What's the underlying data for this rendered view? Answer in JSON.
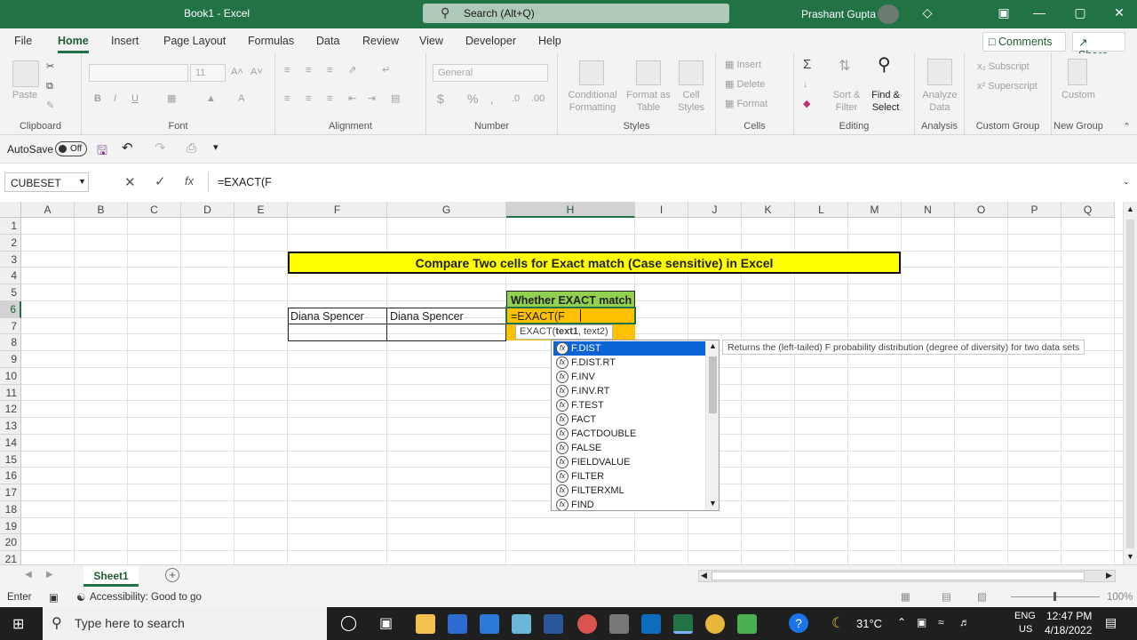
{
  "titlebar": {
    "title": "Book1  -  Excel",
    "search_placeholder": "Search (Alt+Q)",
    "user": "Prashant Gupta"
  },
  "menu": {
    "tabs": [
      "File",
      "Home",
      "Insert",
      "Page Layout",
      "Formulas",
      "Data",
      "Review",
      "View",
      "Developer",
      "Help"
    ],
    "active": "Home",
    "comments": "Comments",
    "share": "Share"
  },
  "ribbon": {
    "clipboard": {
      "label": "Clipboard",
      "paste": "Paste"
    },
    "font": {
      "label": "Font",
      "size": "11"
    },
    "alignment": {
      "label": "Alignment"
    },
    "number": {
      "label": "Number",
      "format": "General"
    },
    "styles": {
      "label": "Styles",
      "conditional": "Conditional\nFormatting",
      "format_table": "Format as\nTable",
      "cell_styles": "Cell\nStyles"
    },
    "cells": {
      "label": "Cells",
      "insert": "Insert",
      "delete": "Delete",
      "format": "Format"
    },
    "editing": {
      "label": "Editing",
      "sort": "Sort &\nFilter",
      "find": "Find &\nSelect"
    },
    "analysis": {
      "label": "Analysis",
      "analyze": "Analyze\nData"
    },
    "custom_group": {
      "label": "Custom Group",
      "subscript": "Subscript",
      "superscript": "Superscript"
    },
    "new_group": {
      "label": "New Group",
      "custom": "Custom"
    }
  },
  "qat": {
    "autosave": "AutoSave",
    "toggle": "Off"
  },
  "formula_bar": {
    "name_box": "CUBESET",
    "formula": "=EXACT(F"
  },
  "columns": [
    "A",
    "B",
    "C",
    "D",
    "E",
    "F",
    "G",
    "H",
    "I",
    "J",
    "K",
    "L",
    "M",
    "N",
    "O",
    "P",
    "Q"
  ],
  "rows": [
    "1",
    "2",
    "3",
    "4",
    "5",
    "6",
    "7",
    "8",
    "9",
    "10",
    "11",
    "12",
    "13",
    "14",
    "15",
    "16",
    "17",
    "18",
    "19",
    "20",
    "21"
  ],
  "sheet": {
    "title": "Compare Two cells for Exact match (Case sensitive) in Excel",
    "header_h5": "Whether EXACT match",
    "f6": "Diana Spencer",
    "g6": "Diana Spencer",
    "h6": "=EXACT(F",
    "tooltip_fn": "EXACT(",
    "tooltip_arg1": "text1",
    "tooltip_rest": ", text2)"
  },
  "autocomplete": {
    "items": [
      "F.DIST",
      "F.DIST.RT",
      "F.INV",
      "F.INV.RT",
      "F.TEST",
      "FACT",
      "FACTDOUBLE",
      "FALSE",
      "FIELDVALUE",
      "FILTER",
      "FILTERXML",
      "FIND"
    ],
    "selected_index": 0,
    "description": "Returns the (left-tailed) F probability distribution (degree of diversity) for two data sets"
  },
  "sheet_tabs": {
    "active": "Sheet1"
  },
  "status": {
    "mode": "Enter",
    "accessibility": "Accessibility: Good to go",
    "zoom": "100%"
  },
  "taskbar": {
    "search": "Type here to search",
    "temp": "31°C",
    "lang1": "ENG",
    "lang2": "US",
    "time": "12:47 PM",
    "date": "4/18/2022"
  },
  "colors": {
    "excel_green": "#217346",
    "title_fill": "#ffff00",
    "header_fill": "#92d050",
    "active_fill": "#ffc000",
    "selection_blue": "#0a64d6"
  }
}
